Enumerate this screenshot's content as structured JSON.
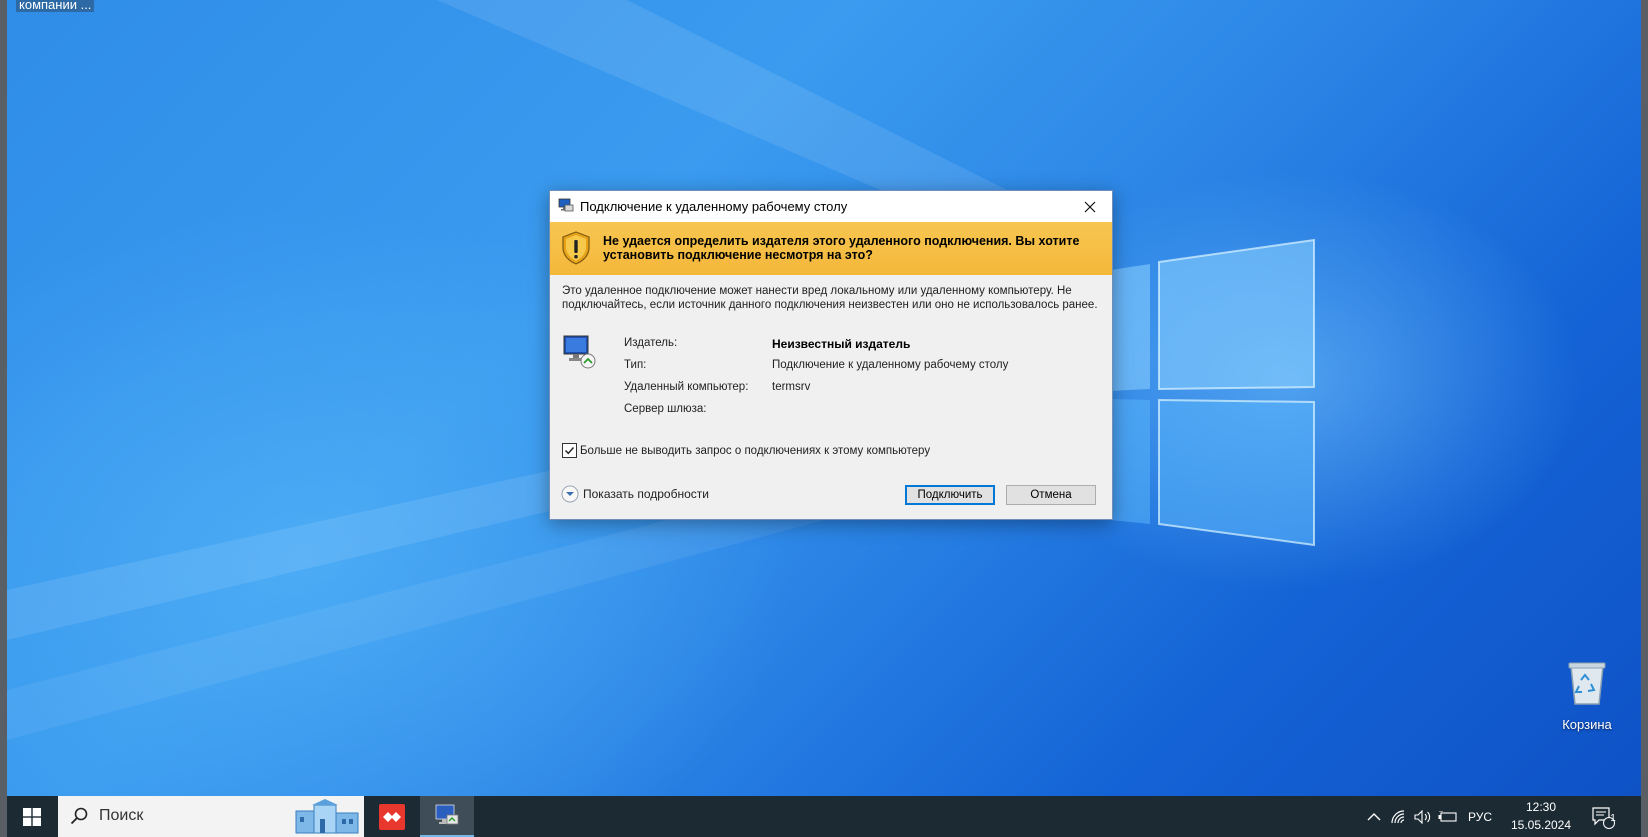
{
  "desktop": {
    "top_label": "компании ...",
    "recycle_bin_label": "Корзина"
  },
  "dialog": {
    "title": "Подключение к удаленному рабочему столу",
    "warning": "Не удается определить издателя этого удаленного подключения. Вы хотите установить подключение несмотря на это?",
    "description": "Это удаленное подключение может нанести вред локальному или удаленному компьютеру. Не подключайтесь, если источник данного подключения неизвестен или оно не использовалось ранее.",
    "fields": [
      {
        "label": "Издатель:",
        "value": "Неизвестный издатель"
      },
      {
        "label": "Тип:",
        "value": "Подключение к удаленному рабочему столу"
      },
      {
        "label": "Удаленный компьютер:",
        "value": "termsrv"
      },
      {
        "label": "Сервер шлюза:",
        "value": ""
      }
    ],
    "remember_label": "Больше не выводить запрос о подключениях к этому компьютеру",
    "remember_checked": true,
    "details_label": "Показать подробности",
    "connect_label": "Подключить",
    "cancel_label": "Отмена"
  },
  "taskbar": {
    "search_placeholder": "Поиск",
    "apps": [
      {
        "name": "anydesk",
        "icon": "anydesk-icon"
      },
      {
        "name": "remote-desktop",
        "icon": "remote-desktop-icon",
        "active": true
      }
    ],
    "tray": {
      "language": "РУС",
      "time": "12:30",
      "date": "15.05.2024",
      "notifications_count": "1"
    }
  },
  "colors": {
    "banner": "#f4b73a",
    "accent": "#0078d7",
    "taskbar": "#1c2a33"
  }
}
